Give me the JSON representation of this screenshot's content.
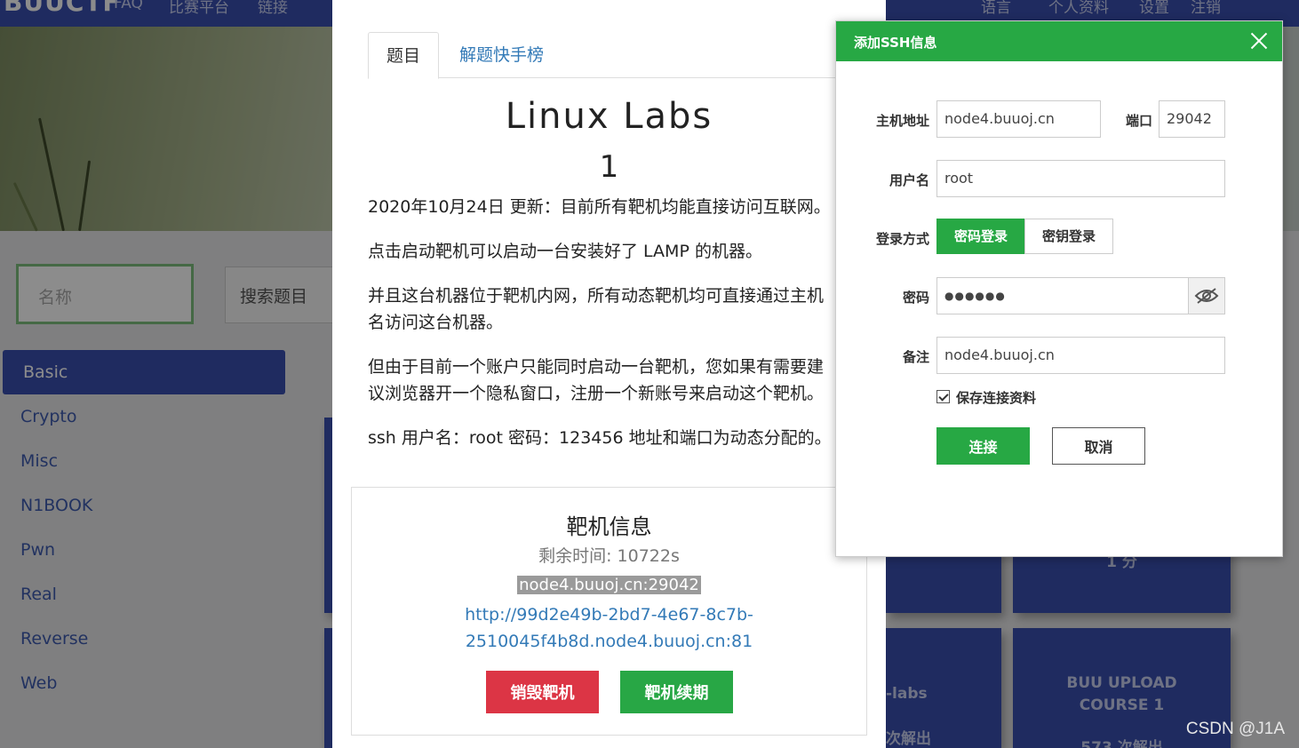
{
  "bg": {
    "brand": "BUUCTF",
    "nav_left": [
      "FAQ",
      "比赛平台",
      "链接"
    ],
    "nav_right": [
      "语言",
      "个人资料",
      "设置",
      "注销"
    ],
    "search_placeholder": "名称",
    "search_button": "搜索题目",
    "categories": [
      "Basic",
      "Crypto",
      "Misc",
      "N1BOOK",
      "Pwn",
      "Real",
      "Reverse",
      "Web"
    ],
    "cards": {
      "card_a": "1 分",
      "card_b_line1": "-labs",
      "card_b_line2": "次解出",
      "card_c_line1": "BUU UPLOAD",
      "card_c_line2": "COURSE 1",
      "card_c_line3": "573 次解出"
    }
  },
  "challenge": {
    "tabs": [
      "题目",
      "解题快手榜"
    ],
    "title": "Linux Labs",
    "score": "1",
    "description": [
      "2020年10月24日 更新：目前所有靶机均能直接访问互联网。",
      "点击启动靶机可以启动一台安装好了 LAMP 的机器。",
      "并且这台机器位于靶机内网，所有动态靶机均可直接通过主机",
      "名访问这台机器。",
      "但由于目前一个账户只能同时启动一台靶机，您如果有需要建",
      "议浏览器开一个隐私窗口，注册一个新账号来启动这个靶机。",
      "ssh 用户名：root 密码：123456 地址和端口为动态分配的。"
    ],
    "target": {
      "title": "靶机信息",
      "remaining": "剩余时间: 10722s",
      "address": "node4.buuoj.cn:29042",
      "url_line1": "http://99d2e49b-2bd7-4e67-8c7b-",
      "url_line2": "2510045f4b8d.node4.buuoj.cn:81",
      "destroy": "销毁靶机",
      "renew": "靶机续期"
    }
  },
  "ssh": {
    "title": "添加SSH信息",
    "host_label": "主机地址",
    "host_value": "node4.buuoj.cn",
    "port_label": "端口",
    "port_value": "29042",
    "user_label": "用户名",
    "user_value": "root",
    "login_label": "登录方式",
    "login_password": "密码登录",
    "login_key": "密钥登录",
    "password_label": "密码",
    "password_value": "●●●●●●",
    "remark_label": "备注",
    "remark_value": "node4.buuoj.cn",
    "save_label": "保存连接资料",
    "connect": "连接",
    "cancel": "取消"
  },
  "watermark": "CSDN @J1A",
  "colors": {
    "nav_blue": "#3a4fb0",
    "green": "#27a844",
    "red": "#dc3545",
    "link": "#337ab7"
  }
}
